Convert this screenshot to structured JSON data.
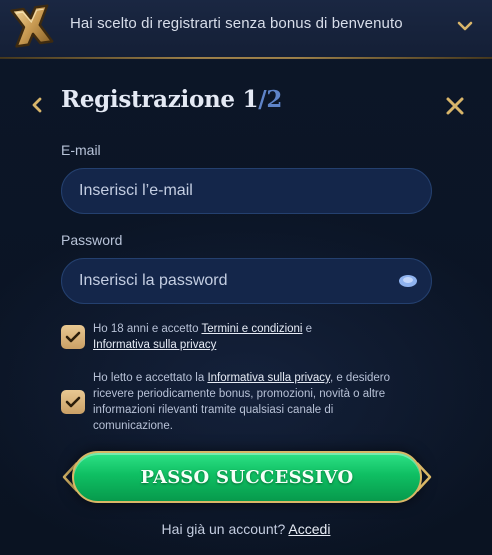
{
  "banner": {
    "text": "Hai scelto di registrarti senza bonus di benvenuto",
    "icon": "cross-icon",
    "toggle_icon": "chevron-down-icon"
  },
  "header": {
    "title": "Registrazione",
    "step_current": "1",
    "step_sep": "/",
    "step_total": "2",
    "back_icon": "chevron-left-icon",
    "close_icon": "close-icon"
  },
  "form": {
    "email": {
      "label": "E-mail",
      "placeholder": "Inserisci l’e-mail",
      "value": ""
    },
    "password": {
      "label": "Password",
      "placeholder": "Inserisci la password",
      "value": "",
      "icon": "eye-icon"
    },
    "consent_terms": {
      "checked": true,
      "text_1": "Ho 18 anni e accetto ",
      "link_1": "Termini e condizioni",
      "text_2": " e",
      "link_2": "Informativa sulla privacy"
    },
    "consent_marketing": {
      "checked": true,
      "text_1": "Ho letto e accettato la ",
      "link_1": "Informativa sulla privacy",
      "text_2": ", e desidero",
      "line_2": "ricevere periodicamente bonus, promozioni, novità o altre",
      "line_3": "informazioni rilevanti tramite qualsiasi canale di",
      "line_4": "comunicazione."
    }
  },
  "actions": {
    "next_label": "PASSO SUCCESSIVO"
  },
  "footer": {
    "prompt": "Hai già un account? ",
    "login_label": "Accedi"
  },
  "colors": {
    "background": "#0b1426",
    "input_bg": "#14264a",
    "accent_gold": "#d9b766",
    "button_green": "#0fbf63",
    "step_blue": "#5f84c8"
  }
}
